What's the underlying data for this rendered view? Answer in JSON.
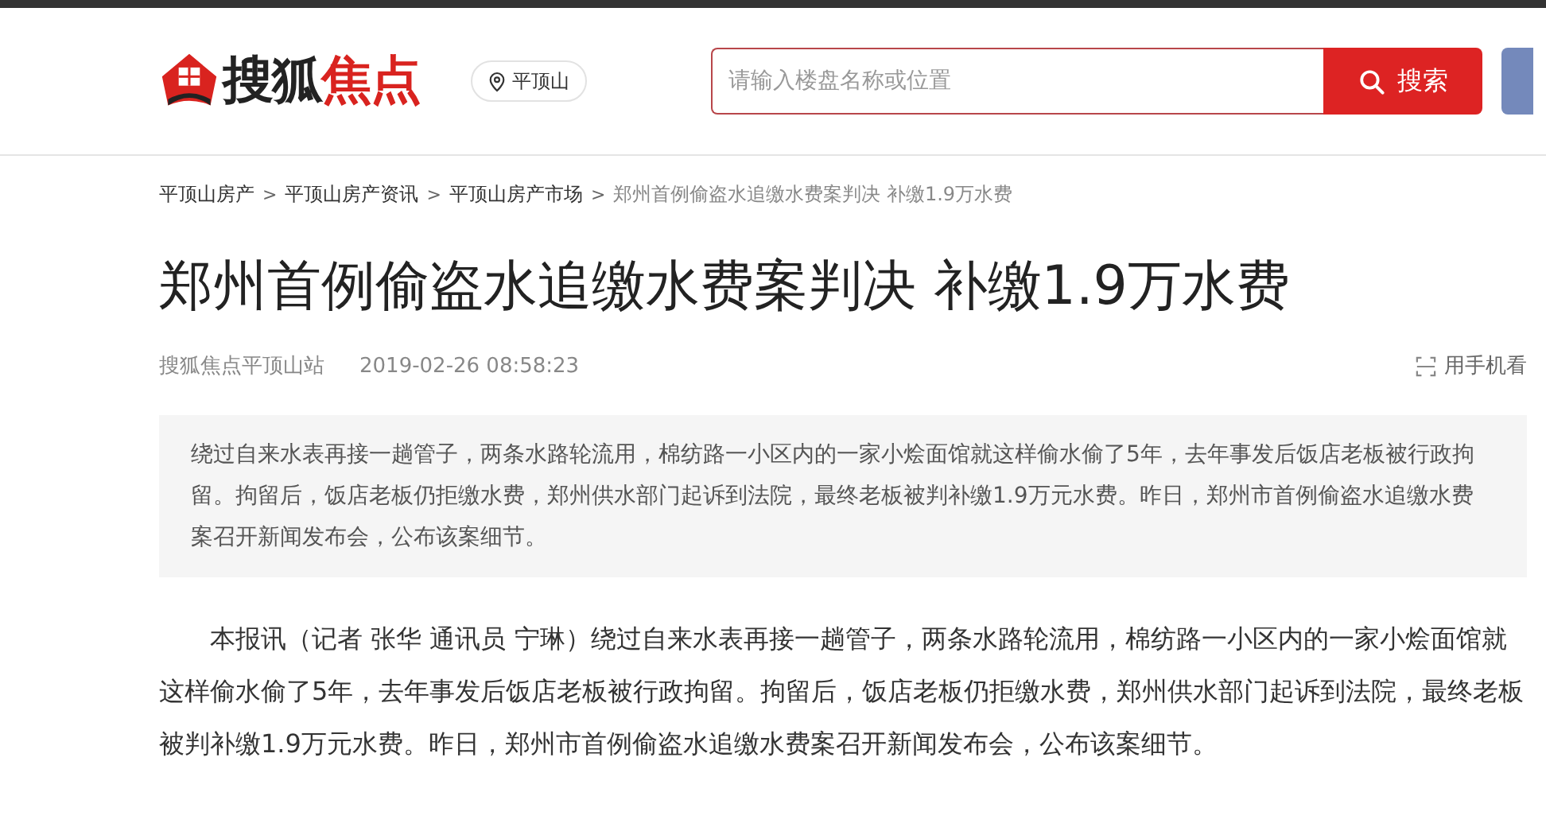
{
  "header": {
    "logo": {
      "part_1": "搜狐",
      "part_2": "焦点"
    },
    "city": "平顶山",
    "search": {
      "placeholder": "请输入楼盘名称或位置",
      "button": "搜索"
    }
  },
  "breadcrumb": [
    {
      "label": "平顶山房产",
      "current": false
    },
    {
      "label": "平顶山房产资讯",
      "current": false
    },
    {
      "label": "平顶山房产市场",
      "current": false
    },
    {
      "label": "郑州首例偷盗水追缴水费案判决 补缴1.9万水费",
      "current": true
    }
  ],
  "breadcrumb_separator": ">",
  "article": {
    "title": "郑州首例偷盗水追缴水费案判决 补缴1.9万水费",
    "source": "搜狐焦点平顶山站",
    "time": "2019-02-26 08:58:23",
    "mobile_link": "用手机看",
    "summary": "绕过自来水表再接一趟管子，两条水路轮流用，棉纺路一小区内的一家小烩面馆就这样偷水偷了5年，去年事发后饭店老板被行政拘留。拘留后，饭店老板仍拒缴水费，郑州供水部门起诉到法院，最终老板被判补缴1.9万元水费。昨日，郑州市首例偷盗水追缴水费案召开新闻发布会，公布该案细节。",
    "paragraphs": [
      "本报讯（记者 张华 通讯员 宁琳）绕过自来水表再接一趟管子，两条水路轮流用，棉纺路一小区内的一家小烩面馆就这样偷水偷了5年，去年事发后饭店老板被行政拘留。拘留后，饭店老板仍拒缴水费，郑州供水部门起诉到法院，最终老板被判补缴1.9万元水费。昨日，郑州市首例偷盗水追缴水费案召开新闻发布会，公布该案细节。"
    ]
  }
}
